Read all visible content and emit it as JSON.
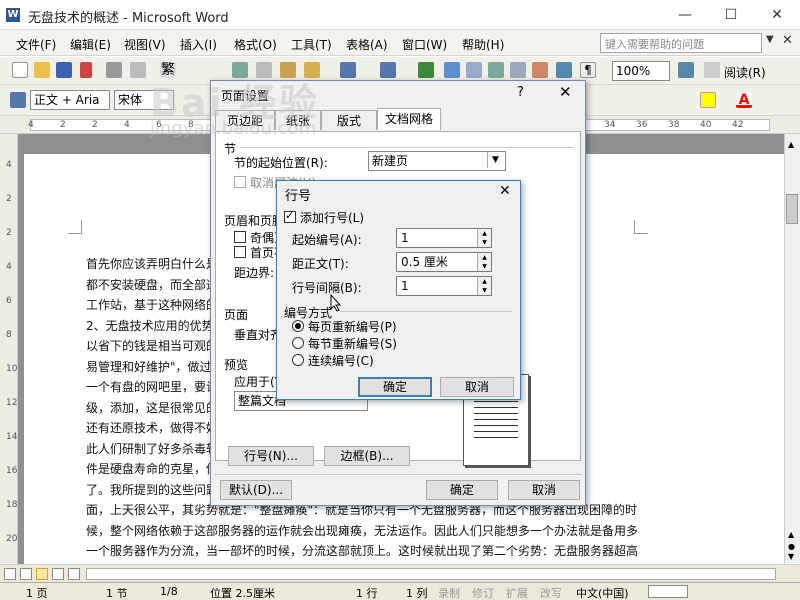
{
  "window": {
    "title": "无盘技术的概述 - Microsoft Word",
    "app_icon": "W"
  },
  "menu": {
    "items": [
      "文件(F)",
      "编辑(E)",
      "视图(V)",
      "插入(I)",
      "格式(O)",
      "工具(T)",
      "表格(A)",
      "窗口(W)",
      "帮助(H)"
    ],
    "help_placeholder": "键入需要帮助的问题"
  },
  "toolbar": {
    "zoom": "100%",
    "read_label": "阅读(R)",
    "style": "正文 + Aria",
    "font": "宋体"
  },
  "ruler": {
    "numbers": [
      "4",
      "2",
      "2",
      "4",
      "6",
      "8",
      "10",
      "12",
      "14",
      "16",
      "18",
      "20",
      "22",
      "24",
      "26",
      "28",
      "30",
      "32",
      "34",
      "36",
      "38",
      "40",
      "42"
    ]
  },
  "vruler": {
    "numbers": [
      "4",
      "2",
      "2",
      "4",
      "6",
      "8",
      "10",
      "12",
      "14",
      "16",
      "18",
      "20"
    ]
  },
  "document": {
    "lines": [
      "首先你应该弄明白什么是无盘技术                                                    有工作上",
      "都不安装硬盘，而全部通                                                              作为无盘",
      "工作站，基于这种网络的",
      "2、无盘技术应用的优势                                                               的网络可",
      "以省下的钱是相当可观的                                                              钱，而是\"",
      "易管理和好维护\"，做过                                                              。比如在",
      "一个有盘的网吧里，要让                                                              软件的升",
      "级，添加，这是很常见的                                                              件事了。",
      "还有还原技术，做得不好                                                              软件，因",
      "此人们研制了好多杀毒软                                                              的聊天软",
      "件是硬盘寿命的克星，你                                                              必就更痛",
      "了。我所提到的这些问题                                                              不好的一",
      "面，上天很公平，其劣势就是：\"整盘瘫痪\"：就是当你只有一个无盘服务器，而这个服务器出现困障的时",
      "候，整个网络依赖于这部服务器的运作就会出现瘫痪，无法运作。因此人们只能想多一个办法就是备用多",
      "一个服务器作为分流，当一部坏的时候，分流这部就顶上。这时候就出现了第二个劣势：无盘服务器超高"
    ]
  },
  "page_setup": {
    "title": "页面设置",
    "help": "?",
    "tabs": [
      "页边距",
      "纸张",
      "版式",
      "文档网格"
    ],
    "section_header": "节",
    "section_start_label": "节的起始位置(R):",
    "section_start_value": "新建页",
    "suppress_endnotes": "取消尾注(U)",
    "headers_header": "页眉和页脚",
    "odd_even": "奇偶页不同(O)",
    "first_page": "首页不同(P)",
    "from_edge": "距边界:",
    "page_header": "页面",
    "vertical_align": "垂直对齐方式(V):",
    "preview_header": "预览",
    "apply_to": "应用于(Y):",
    "apply_value": "整篇文档",
    "line_numbers_btn": "行号(N)...",
    "borders_btn": "边框(B)...",
    "default_btn": "默认(D)...",
    "ok": "确定",
    "cancel": "取消"
  },
  "line_numbers": {
    "title": "行号",
    "add_label": "添加行号(L)",
    "add_checked": true,
    "start_label": "起始编号(A):",
    "start_value": "1",
    "from_text_label": "距正文(T):",
    "from_text_value": "0.5 厘米",
    "interval_label": "行号间隔(B):",
    "interval_value": "1",
    "numbering_label": "编号方式",
    "options": [
      "每页重新编号(P)",
      "每节重新编号(S)",
      "连续编号(C)"
    ],
    "selected_option": 0,
    "ok": "确定",
    "cancel": "取消"
  },
  "status": {
    "page": "1 页",
    "section": "1 节",
    "pages": "1/8",
    "position": "位置 2.5厘米",
    "line": "1 行",
    "col": "1 列",
    "rec": "录制",
    "trk": "修订",
    "ext": "扩展",
    "ovr": "改写",
    "lang": "中文(中国)"
  },
  "watermark": {
    "text": "Bai 经验",
    "url": "jingyan.baidu.com"
  },
  "colors": {
    "accent": "#2b5797",
    "dialog": "#f0f0f0",
    "highlight": "#ffff00",
    "font_color": "#ff0000"
  }
}
